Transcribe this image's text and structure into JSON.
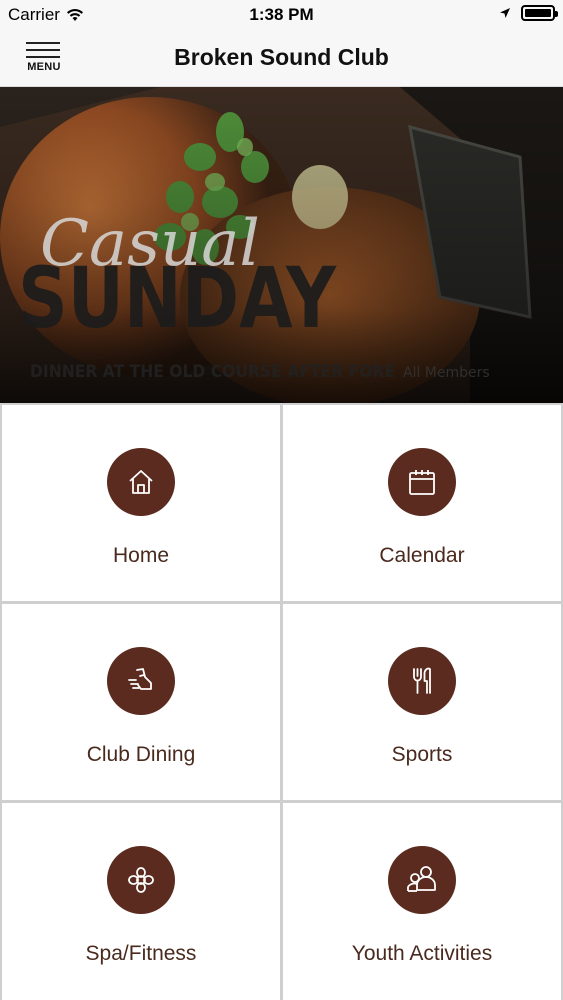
{
  "status_bar": {
    "carrier": "Carrier",
    "time": "1:38 PM"
  },
  "header": {
    "menu_label": "MENU",
    "title": "Broken Sound Club"
  },
  "banner": {
    "script_text": "Casual",
    "headline": "SUNDAY",
    "subline": "DINNER AT THE OLD COURSE AFTER FORE",
    "audience": "All Members"
  },
  "tiles": [
    {
      "label": "Home",
      "icon": "home-icon"
    },
    {
      "label": "Calendar",
      "icon": "calendar-icon"
    },
    {
      "label": "Club Dining",
      "icon": "running-shoe-icon"
    },
    {
      "label": "Sports",
      "icon": "fork-knife-icon"
    },
    {
      "label": "Spa/Fitness",
      "icon": "flower-icon"
    },
    {
      "label": "Youth Activities",
      "icon": "people-icon"
    }
  ],
  "colors": {
    "icon_circle": "#5a2b1e",
    "label_text": "#4a2a1e",
    "grid_divider": "#cfcfcf"
  }
}
